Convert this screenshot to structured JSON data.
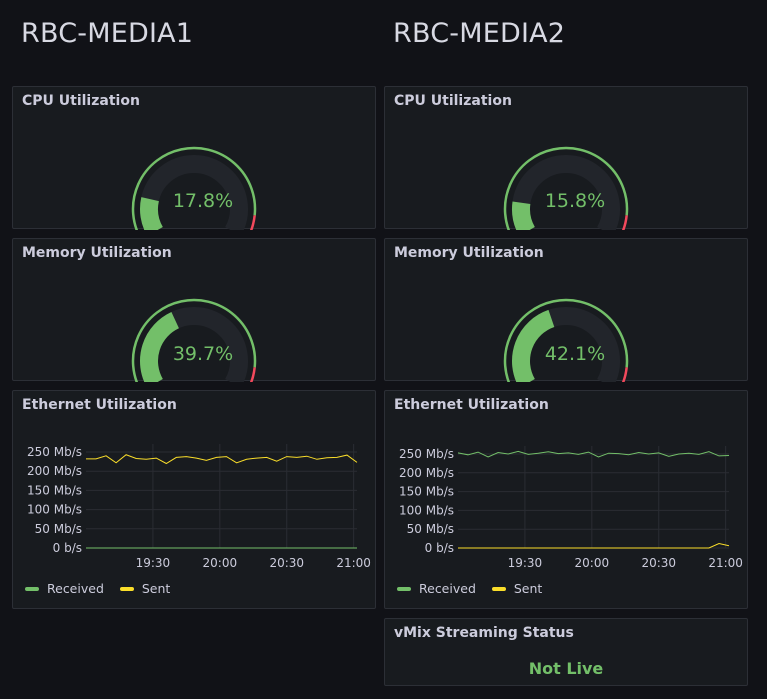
{
  "hosts": [
    {
      "title": "RBC-MEDIA1",
      "cpu": {
        "title": "CPU Utilization",
        "value": 17.8,
        "display": "17.8%"
      },
      "memory": {
        "title": "Memory Utilization",
        "value": 39.7,
        "display": "39.7%"
      },
      "ethernet": {
        "title": "Ethernet Utilization"
      }
    },
    {
      "title": "RBC-MEDIA2",
      "cpu": {
        "title": "CPU Utilization",
        "value": 15.8,
        "display": "15.8%"
      },
      "memory": {
        "title": "Memory Utilization",
        "value": 42.1,
        "display": "42.1%"
      },
      "ethernet": {
        "title": "Ethernet Utilization"
      }
    }
  ],
  "legend": {
    "received": "Received",
    "sent": "Sent"
  },
  "colors": {
    "green": "#73bf69",
    "yellow": "#fade2a",
    "red": "#f2495c",
    "track": "#22252b"
  },
  "vmix": {
    "title": "vMix Streaming Status",
    "status": "Not Live"
  },
  "chart_data": [
    {
      "type": "line",
      "title": "Ethernet Utilization",
      "ylim": [
        0,
        250
      ],
      "yticks": [
        "0 b/s",
        "50 Mb/s",
        "100 Mb/s",
        "150 Mb/s",
        "200 Mb/s",
        "250 Mb/s"
      ],
      "xticks": [
        "19:30",
        "20:00",
        "20:30",
        "21:00"
      ],
      "xtick_minutes": [
        30,
        60,
        90,
        120
      ],
      "x_minutes": [
        0,
        4.5,
        9,
        13.5,
        18,
        22.5,
        27,
        31.5,
        36,
        40.5,
        45,
        49.5,
        54,
        58.5,
        63,
        67.5,
        72,
        76.5,
        81,
        85.5,
        90,
        94.5,
        99,
        103.5,
        108,
        112.5,
        117,
        121.5
      ],
      "series": [
        {
          "name": "Received",
          "values": [
            0,
            0,
            0,
            0,
            0,
            0,
            0,
            0,
            0,
            0,
            0,
            0,
            0,
            0,
            0,
            0,
            0,
            0,
            0,
            0,
            0,
            0,
            0,
            0,
            0,
            0,
            0,
            0
          ]
        },
        {
          "name": "Sent",
          "values": [
            232,
            232,
            240,
            222,
            243,
            233,
            231,
            234,
            220,
            236,
            238,
            234,
            228,
            236,
            238,
            222,
            231,
            234,
            236,
            226,
            238,
            236,
            239,
            231,
            235,
            236,
            242,
            223
          ]
        }
      ],
      "grid": true,
      "legend": "bottom-left"
    },
    {
      "type": "line",
      "title": "Ethernet Utilization",
      "ylim": [
        0,
        250
      ],
      "yticks": [
        "0 b/s",
        "50 Mb/s",
        "100 Mb/s",
        "150 Mb/s",
        "200 Mb/s",
        "250 Mb/s"
      ],
      "xticks": [
        "19:30",
        "20:00",
        "20:30",
        "21:00"
      ],
      "xtick_minutes": [
        30,
        60,
        90,
        120
      ],
      "x_minutes": [
        0,
        4.5,
        9,
        13.5,
        18,
        22.5,
        27,
        31.5,
        36,
        40.5,
        45,
        49.5,
        54,
        58.5,
        63,
        67.5,
        72,
        76.5,
        81,
        85.5,
        90,
        94.5,
        99,
        103.5,
        108,
        112.5,
        117,
        121.5
      ],
      "series": [
        {
          "name": "Received",
          "values": [
            253,
            248,
            255,
            242,
            254,
            250,
            257,
            249,
            252,
            256,
            251,
            253,
            249,
            255,
            242,
            252,
            251,
            248,
            254,
            250,
            253,
            244,
            250,
            252,
            249,
            256,
            245,
            246
          ]
        },
        {
          "name": "Sent",
          "values": [
            0,
            0,
            0,
            0,
            0,
            0,
            0,
            0,
            0,
            0,
            0,
            0,
            0,
            0,
            0,
            0,
            0,
            0,
            0,
            0,
            0,
            0,
            0,
            0,
            0,
            0,
            12,
            6
          ]
        }
      ],
      "grid": true,
      "legend": "bottom-left"
    }
  ]
}
